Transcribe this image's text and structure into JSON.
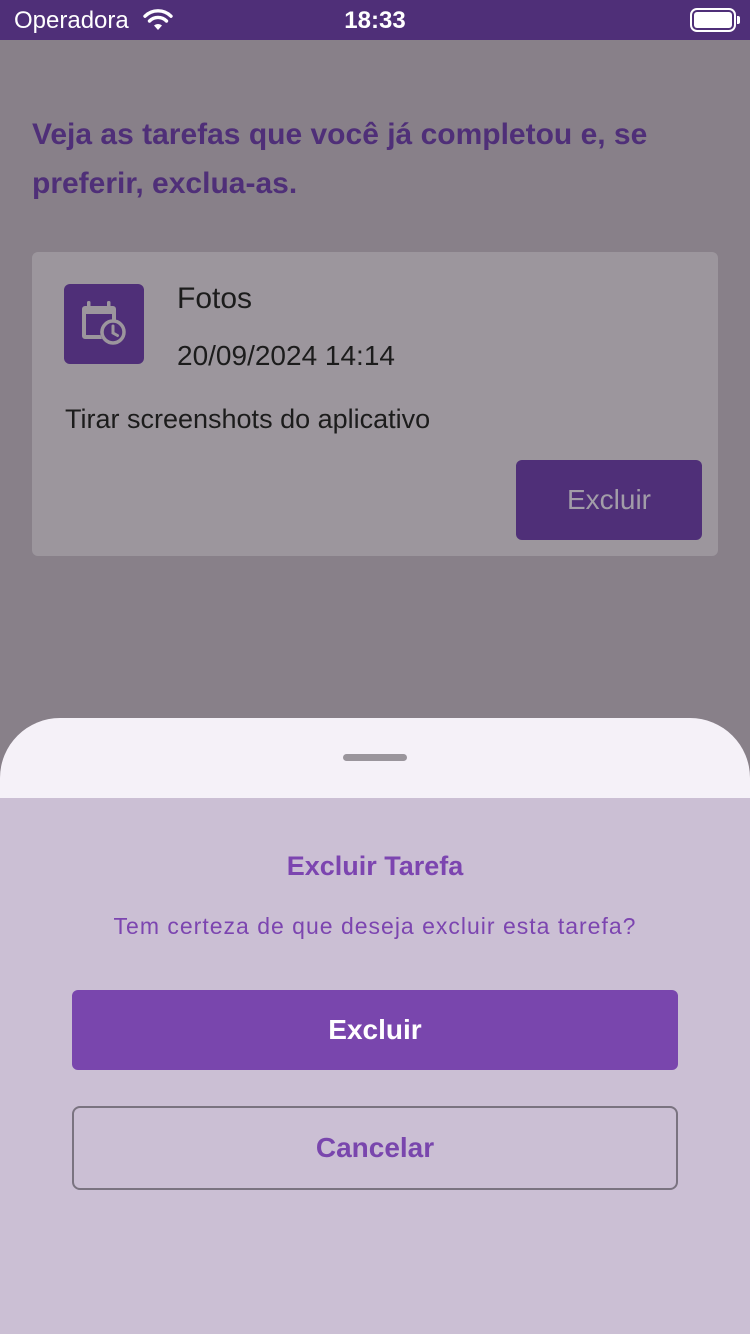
{
  "status_bar": {
    "carrier": "Operadora",
    "time": "18:33"
  },
  "main": {
    "intro": "Veja as tarefas que você já completou e, se preferir, exclua-as.",
    "tasks": [
      {
        "title": "Fotos",
        "datetime": "20/09/2024 14:14",
        "description": "Tirar screenshots do aplicativo",
        "delete_label": "Excluir",
        "icon": "calendar-clock-icon"
      }
    ]
  },
  "sheet": {
    "title": "Excluir Tarefa",
    "message": "Tem certeza de que deseja excluir esta tarefa?",
    "confirm_label": "Excluir",
    "cancel_label": "Cancelar"
  },
  "colors": {
    "primary": "#7946ad",
    "primary_dark": "#4f2f78",
    "scrim": "#888089",
    "sheet_background": "#cbbfd4"
  }
}
